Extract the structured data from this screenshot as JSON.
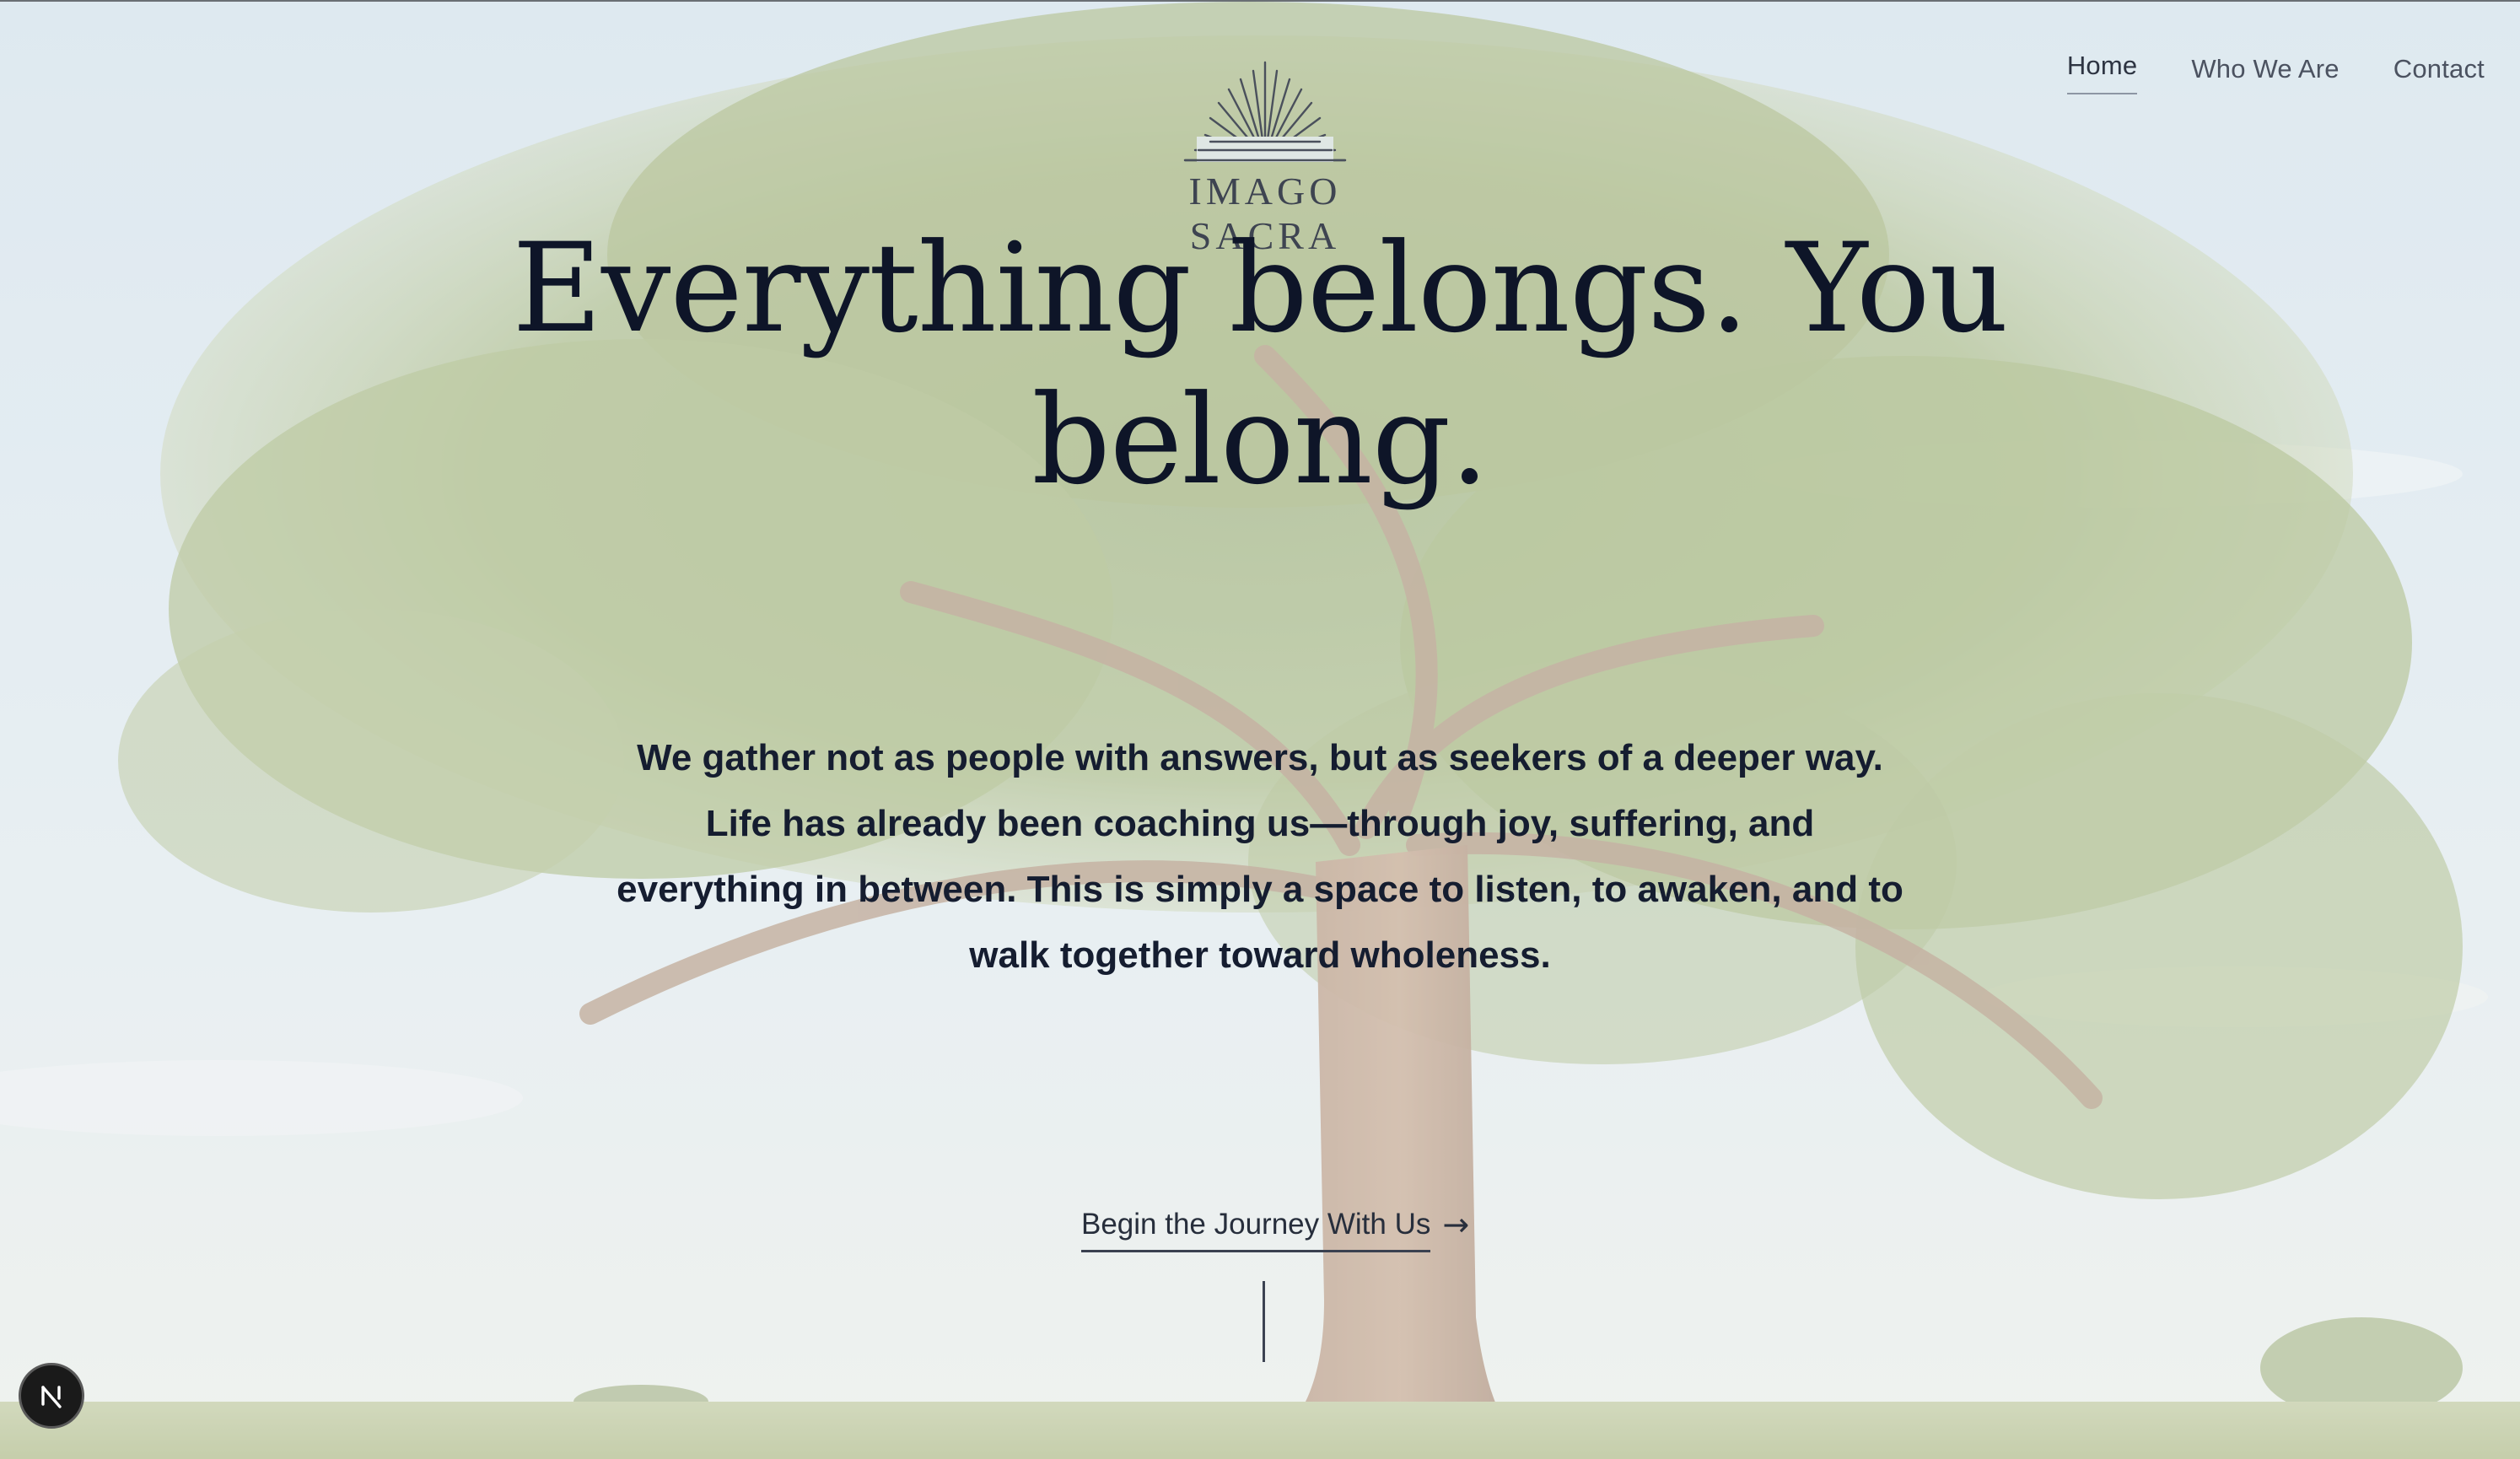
{
  "brand": {
    "name": "IMAGO SACRA",
    "logo_icon": "sunburst-icon"
  },
  "nav": {
    "items": [
      {
        "label": "Home",
        "active": true
      },
      {
        "label": "Who We Are",
        "active": false
      },
      {
        "label": "Contact",
        "active": false
      }
    ]
  },
  "hero": {
    "headline": "Everything belongs. You belong.",
    "intro": "We gather not as people with answers, but as seekers of a deeper way. Life has already been coaching us—through joy, suffering, and everything in between. This is simply a space to listen, to awaken, and to walk together toward wholeness.",
    "cta_label": "Begin the Journey With Us",
    "cta_arrow": "→",
    "background": "tree-photo"
  },
  "dev_badge": {
    "icon": "nextjs-n-icon"
  },
  "colors": {
    "text": "#0e1528",
    "nav": "#4b5260",
    "sky": "#dbe8f0",
    "foliage": "#8fa869"
  }
}
